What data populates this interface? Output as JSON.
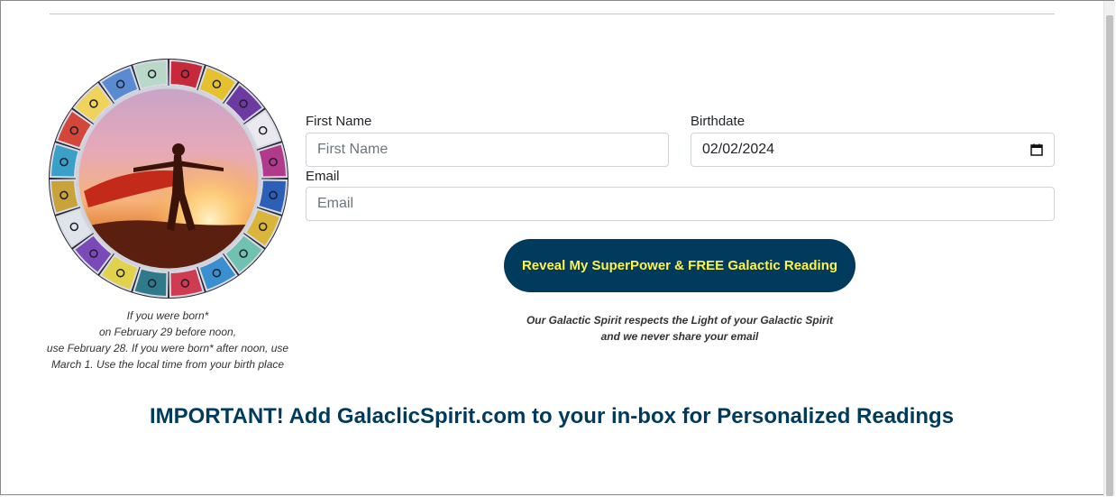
{
  "form": {
    "first_name": {
      "label": "First Name",
      "placeholder": "First Name",
      "value": ""
    },
    "birthdate": {
      "label": "Birthdate",
      "value": "02/02/2024"
    },
    "email": {
      "label": "Email",
      "placeholder": "Email",
      "value": ""
    },
    "submit_label": "Reveal My SuperPower & FREE Galactic Reading",
    "privacy_line1": "Our Galactic Spirit respects the Light of your Galactic Spirit",
    "privacy_line2": "and we never share your email"
  },
  "wheel": {
    "born_note_lines": [
      "If you were born*",
      "on February 29 before noon,",
      "use February 28. If you were born* after noon, use",
      "March 1. Use the local time from your birth place"
    ]
  },
  "important_message": "IMPORTANT! Add GalaclicSpirit.com to your in-box for Personalized Readings",
  "colors": {
    "brand_navy": "#003a5d",
    "button_text": "#fff34a"
  },
  "icons": {
    "date_picker": "calendar-icon"
  }
}
